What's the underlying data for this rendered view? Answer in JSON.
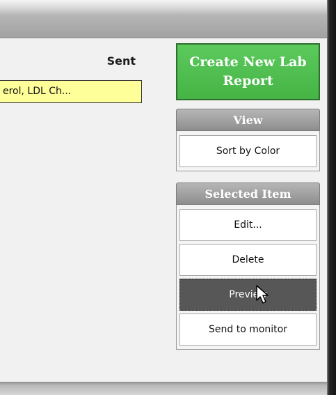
{
  "list": {
    "column_header": "Sent",
    "row_text": "erol, LDL Ch..."
  },
  "sidebar": {
    "create_button": {
      "line1": "Create New Lab",
      "line2": "Report"
    },
    "view_panel": {
      "title": "View",
      "buttons": [
        {
          "label": "Sort by Color"
        }
      ]
    },
    "selected_panel": {
      "title": "Selected Item",
      "buttons": [
        {
          "label": "Edit..."
        },
        {
          "label": "Delete"
        },
        {
          "label": "Preview",
          "state": "pressed"
        },
        {
          "label": "Send to monitor"
        }
      ]
    }
  },
  "colors": {
    "create_button": "#45b445",
    "report_row_highlight": "#ffff99",
    "panel_header": "#9e9e9e",
    "pressed_button": "#575757"
  },
  "icons": [
    "mouse-pointer-icon"
  ]
}
